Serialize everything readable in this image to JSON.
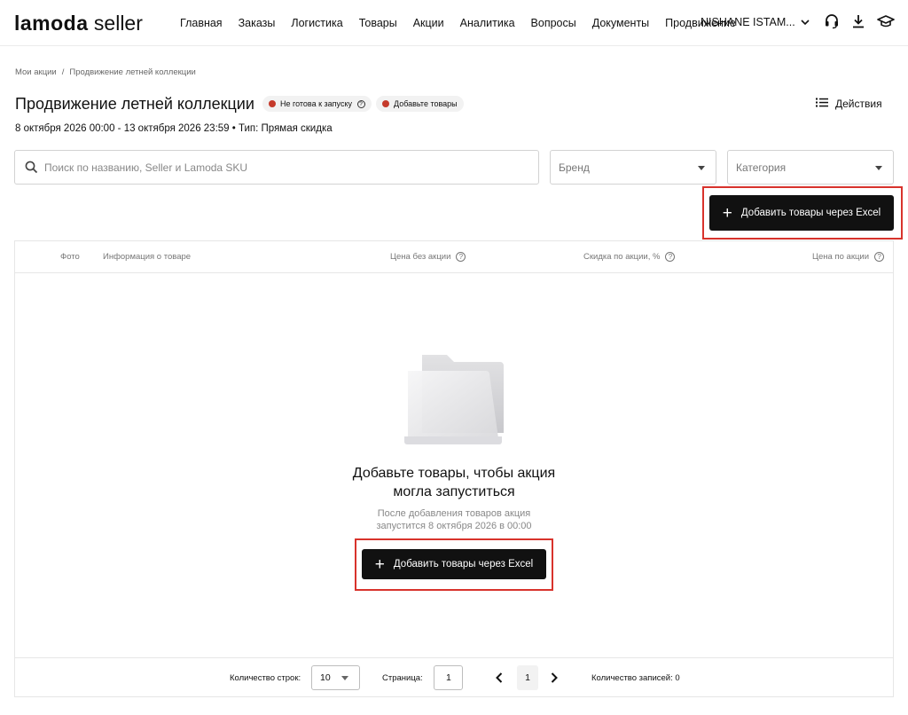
{
  "header": {
    "logo_brand": "lamoda",
    "logo_sub": "seller",
    "nav": [
      "Главная",
      "Заказы",
      "Логистика",
      "Товары",
      "Акции",
      "Аналитика",
      "Вопросы",
      "Документы",
      "Продвижение"
    ],
    "user_name": "NISHANE ISTAM...",
    "icons": [
      "headset-icon",
      "download-icon",
      "graduation-cap-icon"
    ]
  },
  "breadcrumb": [
    "Мои акции",
    "/",
    "Продвижение летней коллекции"
  ],
  "page": {
    "title": "Продвижение летней коллекции",
    "status_not_ready": "Не готова к запуску",
    "status_add": "Добавьте товары",
    "status_color": "#c53a2b",
    "actions_label": "Действия",
    "meta": "8 октября 2026 00:00 - 13 октября 2026 23:59  •  Тип: Прямая скидка"
  },
  "filters": {
    "search_placeholder": "Поиск по названию, Seller и Lamoda SKU",
    "search_value": "",
    "brand_placeholder": "Бренд",
    "category_placeholder": "Категория"
  },
  "add_button_label": "Добавить товары через Excel",
  "table": {
    "columns": [
      "Фото",
      "Информация о товаре",
      "Цена без акции",
      "Скидка по акции, %",
      "Цена по акции"
    ],
    "empty_title_line1": "Добавьте товары, чтобы акция",
    "empty_title_line2": "могла запуститься",
    "empty_sub_line1": "После добавления товаров акция",
    "empty_sub_line2": "запустится 8 октября 2026 в 00:00"
  },
  "footer": {
    "rows_label": "Количество строк:",
    "rows_value": "10",
    "page_label": "Страница:",
    "page_input": "1",
    "current_page": "1",
    "records_label": "Количество записей: 0"
  },
  "colors": {
    "accent_dark": "#111111",
    "highlight": "#d8332c"
  }
}
